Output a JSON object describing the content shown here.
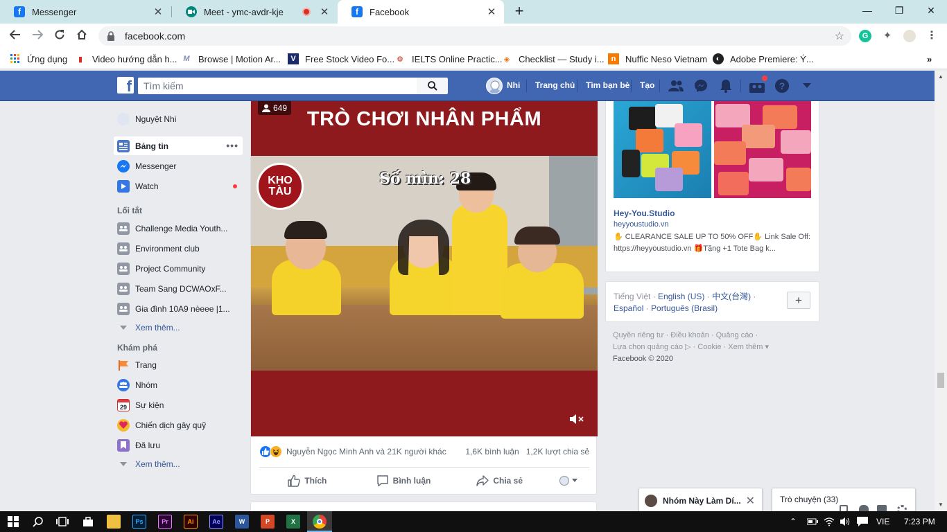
{
  "browser": {
    "tabs": [
      {
        "title": "Messenger",
        "favicon": "facebook-favicon",
        "active": false
      },
      {
        "title": "Meet - ymc-avdr-kje",
        "favicon": "meet-favicon",
        "active": false,
        "recording": true
      },
      {
        "title": "Facebook",
        "favicon": "facebook-favicon",
        "active": true
      }
    ],
    "url": "facebook.com",
    "bookmarks": [
      "Ứng dụng",
      "Video hướng dẫn h...",
      "Browse | Motion Ar...",
      "Free Stock Video Fo...",
      "IELTS Online Practic...",
      "Checklist — Study i...",
      "Nuffic Neso Vietnam",
      "Adobe Premiere: Ý..."
    ]
  },
  "fb_header": {
    "search_placeholder": "Tìm kiếm",
    "profile_name": "Nhi",
    "nav": [
      "Trang chủ",
      "Tìm bạn bè",
      "Tạo"
    ]
  },
  "left_nav": {
    "profile": "Nguyệt Nhi",
    "main": [
      {
        "label": "Bảng tin",
        "icon": "news-feed-icon"
      },
      {
        "label": "Messenger",
        "icon": "messenger-icon"
      },
      {
        "label": "Watch",
        "icon": "watch-icon"
      }
    ],
    "shortcuts_heading": "Lối tắt",
    "shortcuts": [
      "Challenge Media Youth...",
      "Environment club",
      "Project Community",
      "Team Sang DCWAOxF...",
      "Gia đình 10A9 nèeee |1..."
    ],
    "see_more": "Xem thêm...",
    "explore_heading": "Khám phá",
    "explore": [
      {
        "label": "Trang",
        "icon": "flag-icon"
      },
      {
        "label": "Nhóm",
        "icon": "groups-icon"
      },
      {
        "label": "Sự kiện",
        "icon": "calendar-icon"
      },
      {
        "label": "Chiến dịch gây quỹ",
        "icon": "fundraiser-icon"
      },
      {
        "label": "Đã lưu",
        "icon": "saved-icon"
      }
    ],
    "see_more_2": "Xem thêm..."
  },
  "post": {
    "view_count": "649",
    "video_title": "TRÒ CHƠI NHÂN PHẨM",
    "scene_caption": "Số mìn: 28",
    "channel_logo": "KHO TÀU",
    "reactions_text": "Nguyễn Ngọc Minh Anh và 21K người khác",
    "comments": "1,6K bình luận",
    "shares": "1,2K lượt chia sẻ",
    "actions": [
      "Thích",
      "Bình luận",
      "Chia sẻ"
    ]
  },
  "ad": {
    "name": "Hey-You.Studio",
    "url": "heyyoustudio.vn",
    "text": "✋ CLEARANCE SALE UP TO 50% OFF✋ Link Sale Off: https://heyyoustudio.vn 🎁Tặng +1 Tote Bag k..."
  },
  "languages": {
    "current": "Tiếng Việt",
    "others": [
      "English (US)",
      "中文(台灣)",
      "Español",
      "Português (Brasil)"
    ],
    "add_label": "+"
  },
  "footer": {
    "links": [
      "Quyền riêng tư",
      "Điều khoản",
      "Quảng cáo",
      "Lựa chọn quảng cáo",
      "Cookie",
      "Xem thêm"
    ],
    "copyright": "Facebook © 2020"
  },
  "chat": {
    "open_chat": "Nhóm Này Làm Dí...",
    "chat_list": "Trò chuyện (33)"
  },
  "taskbar": {
    "language": "VIE",
    "time": "7:23 PM"
  }
}
